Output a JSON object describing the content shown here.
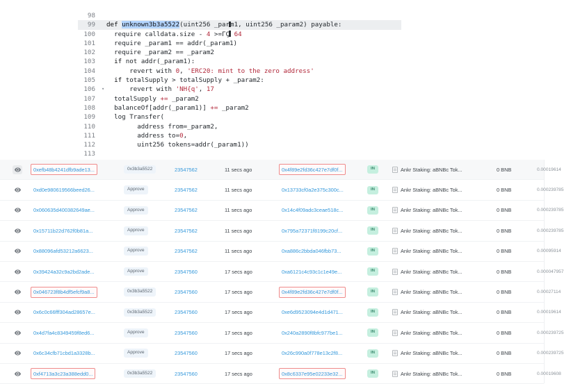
{
  "code_panel": {
    "lines": [
      {
        "num": "98",
        "fold": "",
        "highlight": false,
        "segments": []
      },
      {
        "num": "99",
        "fold": "",
        "highlight": true,
        "segments": [
          {
            "t": "def ",
            "c": "tok-kw"
          },
          {
            "t": "unknown3b3a5522",
            "c": "tok-sel"
          },
          {
            "t": "(uint256 _par",
            "c": ""
          },
          {
            "t": "CARET",
            "c": "caret"
          },
          {
            "t": "m1, uint256 _param2) payable:",
            "c": ""
          }
        ]
      },
      {
        "num": "100",
        "fold": "",
        "highlight": false,
        "segments": [
          {
            "t": "  require calldata.size - ",
            "c": ""
          },
          {
            "t": "4",
            "c": "tok-num"
          },
          {
            "t": " >=ΓÇ",
            "c": ""
          },
          {
            "t": "CARET",
            "c": "caret"
          },
          {
            "t": " ",
            "c": ""
          },
          {
            "t": "64",
            "c": "tok-num"
          }
        ]
      },
      {
        "num": "101",
        "fold": "",
        "highlight": false,
        "segments": [
          {
            "t": "  require _param1 == addr(_param1)",
            "c": ""
          }
        ]
      },
      {
        "num": "102",
        "fold": "",
        "highlight": false,
        "segments": [
          {
            "t": "  require _param2 == _param2",
            "c": ""
          }
        ]
      },
      {
        "num": "103",
        "fold": "",
        "highlight": false,
        "segments": [
          {
            "t": "  ",
            "c": ""
          },
          {
            "t": "if",
            "c": "tok-kw"
          },
          {
            "t": " not addr(_param1):",
            "c": ""
          }
        ]
      },
      {
        "num": "104",
        "fold": "",
        "highlight": false,
        "segments": [
          {
            "t": "      revert with ",
            "c": ""
          },
          {
            "t": "0",
            "c": "tok-num"
          },
          {
            "t": ", ",
            "c": ""
          },
          {
            "t": "'ERC20: mint to the zero address'",
            "c": "tok-str"
          }
        ]
      },
      {
        "num": "105",
        "fold": "",
        "highlight": false,
        "segments": [
          {
            "t": "  ",
            "c": ""
          },
          {
            "t": "if",
            "c": "tok-kw"
          },
          {
            "t": " totalSupply > totalSupply + _param2:",
            "c": ""
          }
        ]
      },
      {
        "num": "106",
        "fold": "▾",
        "highlight": false,
        "segments": [
          {
            "t": "      revert with ",
            "c": ""
          },
          {
            "t": "'NH{q'",
            "c": "tok-str"
          },
          {
            "t": ", ",
            "c": ""
          },
          {
            "t": "17",
            "c": "tok-num"
          }
        ]
      },
      {
        "num": "107",
        "fold": "",
        "highlight": false,
        "segments": [
          {
            "t": "  totalSupply ",
            "c": ""
          },
          {
            "t": "+=",
            "c": "tok-num"
          },
          {
            "t": " _param2",
            "c": ""
          }
        ]
      },
      {
        "num": "108",
        "fold": "",
        "highlight": false,
        "segments": [
          {
            "t": "  balanceOf[addr(_param1)] ",
            "c": ""
          },
          {
            "t": "+=",
            "c": "tok-num"
          },
          {
            "t": " _param2",
            "c": ""
          }
        ]
      },
      {
        "num": "109",
        "fold": "",
        "highlight": false,
        "segments": [
          {
            "t": "  log Transfer(",
            "c": ""
          }
        ]
      },
      {
        "num": "110",
        "fold": "",
        "highlight": false,
        "segments": [
          {
            "t": "        address from=_param2,",
            "c": ""
          }
        ]
      },
      {
        "num": "111",
        "fold": "",
        "highlight": false,
        "segments": [
          {
            "t": "        address to=",
            "c": ""
          },
          {
            "t": "0",
            "c": "tok-num"
          },
          {
            "t": ",",
            "c": ""
          }
        ]
      },
      {
        "num": "112",
        "fold": "",
        "highlight": false,
        "segments": [
          {
            "t": "        uint256 tokens=addr(_param1))",
            "c": ""
          }
        ]
      },
      {
        "num": "113",
        "fold": "",
        "highlight": false,
        "segments": []
      }
    ]
  },
  "transactions": {
    "direction_label": "IN",
    "rows": [
      {
        "hash": "0xefb48b4241dfb9ade13...",
        "hash_highlighted": true,
        "eye_active": true,
        "row_selected": true,
        "method": "0x3b3a5522",
        "block": "23547562",
        "age": "11 secs ago",
        "to": "0x4f89e2fd36c427e7df0f...",
        "to_highlighted": true,
        "contract": "Ankr Staking: aBNBc Tok...",
        "value": "0 BNB",
        "fee": "0.00019614"
      },
      {
        "hash": "0xd0e980619566beed26...",
        "hash_highlighted": false,
        "eye_active": false,
        "row_selected": false,
        "method": "Approve",
        "block": "23547562",
        "age": "11 secs ago",
        "to": "0x13733cf0a2e375c300c...",
        "to_highlighted": false,
        "contract": "Ankr Staking: aBNBc Tok...",
        "value": "0 BNB",
        "fee": "0.000239785"
      },
      {
        "hash": "0x060635d400382649ae...",
        "hash_highlighted": false,
        "eye_active": false,
        "row_selected": false,
        "method": "Approve",
        "block": "23547562",
        "age": "11 secs ago",
        "to": "0x14c4f09adc3ceae518c...",
        "to_highlighted": false,
        "contract": "Ankr Staking: aBNBc Tok...",
        "value": "0 BNB",
        "fee": "0.000239785"
      },
      {
        "hash": "0x15711b22d762f0b81a...",
        "hash_highlighted": false,
        "eye_active": false,
        "row_selected": false,
        "method": "Approve",
        "block": "23547562",
        "age": "11 secs ago",
        "to": "0x795a72371f8199c20cf...",
        "to_highlighted": false,
        "contract": "Ankr Staking: aBNBc Tok...",
        "value": "0 BNB",
        "fee": "0.000239785"
      },
      {
        "hash": "0x88096afd53212a6623...",
        "hash_highlighted": false,
        "eye_active": false,
        "row_selected": false,
        "method": "Approve",
        "block": "23547562",
        "age": "11 secs ago",
        "to": "0xa886c2bbda046fbb73...",
        "to_highlighted": false,
        "contract": "Ankr Staking: aBNBc Tok...",
        "value": "0 BNB",
        "fee": "0.00095914"
      },
      {
        "hash": "0x39424a32c9a2bd2ade...",
        "hash_highlighted": false,
        "eye_active": false,
        "row_selected": false,
        "method": "Approve",
        "block": "23547560",
        "age": "17 secs ago",
        "to": "0xa6121c4c93c1c1e49e...",
        "to_highlighted": false,
        "contract": "Ankr Staking: aBNBc Tok...",
        "value": "0 BNB",
        "fee": "0.000047957"
      },
      {
        "hash": "0x046723f8b4df5efcf9a8...",
        "hash_highlighted": true,
        "eye_active": false,
        "row_selected": false,
        "method": "0x3b3a5522",
        "block": "23547560",
        "age": "17 secs ago",
        "to": "0x4f89e2fd36c427e7df0f...",
        "to_highlighted": true,
        "contract": "Ankr Staking: aBNBc Tok...",
        "value": "0 BNB",
        "fee": "0.00027114"
      },
      {
        "hash": "0x6c0c66fff304ad28657e...",
        "hash_highlighted": false,
        "eye_active": false,
        "row_selected": false,
        "method": "0x3b3a5522",
        "block": "23547560",
        "age": "17 secs ago",
        "to": "0xe6d9523094e4d1d471...",
        "to_highlighted": false,
        "contract": "Ankr Staking: aBNBc Tok...",
        "value": "0 BNB",
        "fee": "0.00019614"
      },
      {
        "hash": "0x4d7fa4c8349459f8ed6...",
        "hash_highlighted": false,
        "eye_active": false,
        "row_selected": false,
        "method": "Approve",
        "block": "23547560",
        "age": "17 secs ago",
        "to": "0x240a2890f8bfc977be1...",
        "to_highlighted": false,
        "contract": "Ankr Staking: aBNBc Tok...",
        "value": "0 BNB",
        "fee": "0.000239725"
      },
      {
        "hash": "0x6c34cfb71cbd1a3328b...",
        "hash_highlighted": false,
        "eye_active": false,
        "row_selected": false,
        "method": "Approve",
        "block": "23547560",
        "age": "17 secs ago",
        "to": "0x26c990a0f778e13c2f8...",
        "to_highlighted": false,
        "contract": "Ankr Staking: aBNBc Tok...",
        "value": "0 BNB",
        "fee": "0.000239725"
      },
      {
        "hash": "0xf4713a3c23a388edd0...",
        "hash_highlighted": true,
        "eye_active": false,
        "row_selected": false,
        "method": "0x3b3a5522",
        "block": "23547560",
        "age": "17 secs ago",
        "to": "0x8c6337e95e02233e32...",
        "to_highlighted": true,
        "contract": "Ankr Staking: aBNBc Tok...",
        "value": "0 BNB",
        "fee": "0.00019608"
      }
    ]
  },
  "colors": {
    "link": "#3498db",
    "highlight_border": "#ef8b8b",
    "direction_badge_bg": "#c5efdf",
    "direction_badge_fg": "#36876a",
    "method_pill_bg": "#eef4fa",
    "code_selection": "#b4d5fe"
  }
}
